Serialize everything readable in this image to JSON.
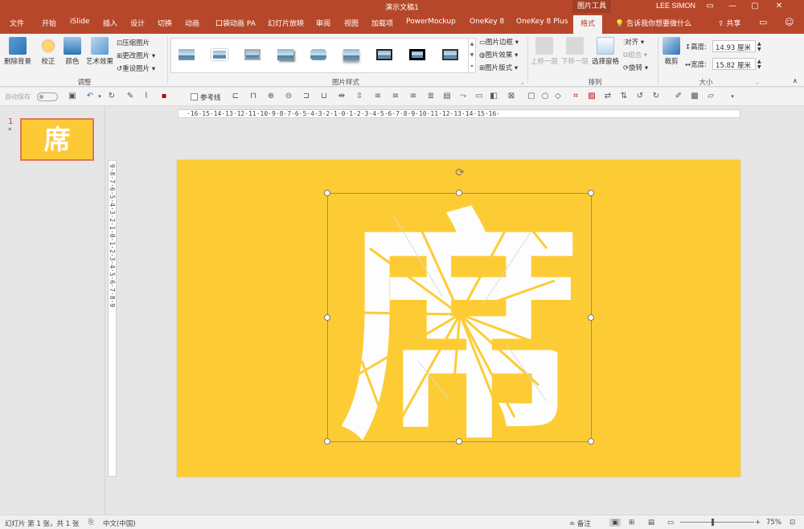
{
  "window": {
    "title": "演示文稿1",
    "picture_tools_label": "图片工具",
    "user": "LEE SIMON",
    "controls": [
      "▭",
      "—",
      "▢",
      "✕"
    ]
  },
  "tabs": [
    {
      "label": "文件"
    },
    {
      "label": "开始"
    },
    {
      "label": "iSlide"
    },
    {
      "label": "插入"
    },
    {
      "label": "设计"
    },
    {
      "label": "切换"
    },
    {
      "label": "动画"
    },
    {
      "label": "口袋动画 PA"
    },
    {
      "label": "幻灯片放映"
    },
    {
      "label": "审阅"
    },
    {
      "label": "视图"
    },
    {
      "label": "加载项"
    },
    {
      "label": "PowerMockup"
    },
    {
      "label": "OneKey 8"
    },
    {
      "label": "OneKey 8 Plus"
    },
    {
      "label": "格式",
      "active": true
    }
  ],
  "tell_me": "告诉我你想要做什么",
  "share": "共享",
  "ribbon": {
    "remove_bg": "删除背景",
    "correct": "校正",
    "color": "颜色",
    "artistic": "艺术效果",
    "compress": "压缩图片",
    "change": "更改图片",
    "reset": "重设图片",
    "adjust_group": "调整",
    "styles_group": "图片样式",
    "border": "图片边框",
    "effects": "图片效果",
    "layout": "图片版式",
    "bring_forward": "上移一层",
    "send_backward": "下移一层",
    "selection_pane": "选择窗格",
    "align": "对齐",
    "group": "组合",
    "rotate": "旋转",
    "arrange_group": "排列",
    "crop": "裁剪",
    "height_label": "高度:",
    "height_value": "14.93 厘米",
    "width_label": "宽度:",
    "width_value": "15.82 厘米",
    "size_group": "大小"
  },
  "toolbar": {
    "autosave": "自动保存",
    "guides": "参考线"
  },
  "thumbnail": {
    "number": "1",
    "star": "*",
    "text": "席"
  },
  "rulers": {
    "horizontal": "·16·15·14·13·12·11·10·9·8·7·6·5·4·3·2·1·0·1·2·3·4·5·6·7·8·9·10·11·12·13·14·15·16·",
    "vertical": "9·8·7·6·5·4·3·2·1·0·1·2·3·4·5·6·7·8·9"
  },
  "slide": {
    "background": "#fdcc35",
    "art_char": "席",
    "art_color": "#fdfdfd",
    "crack_color": "#fdcc35"
  },
  "status": {
    "slide_info": "幻灯片 第 1 张，共 1 张",
    "language": "中文(中国)",
    "notes": "备注",
    "zoom": "75%"
  },
  "colors": {
    "accent": "#b7472a",
    "ribbon_bg": "#f3f3f3",
    "canvas_bg": "#e6e6e6"
  }
}
